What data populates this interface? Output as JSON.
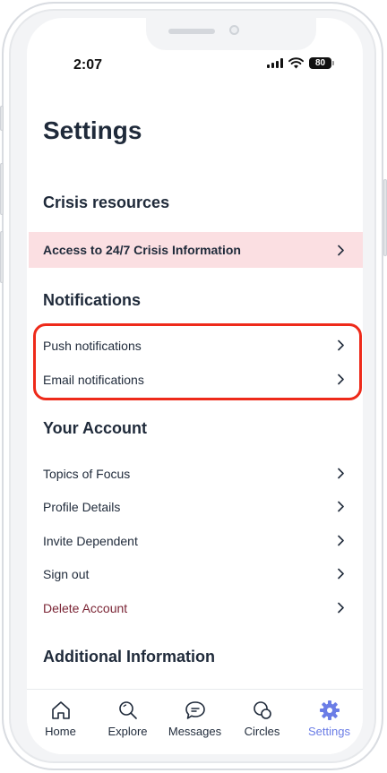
{
  "status_bar": {
    "time": "2:07",
    "battery": "80"
  },
  "page": {
    "title": "Settings"
  },
  "sections": {
    "crisis": {
      "title": "Crisis resources",
      "item": "Access to 24/7 Crisis Information"
    },
    "notifications": {
      "title": "Notifications",
      "items": [
        "Push notifications",
        "Email notifications"
      ]
    },
    "account": {
      "title": "Your Account",
      "items": [
        "Topics of Focus",
        "Profile Details",
        "Invite Dependent",
        "Sign out",
        "Delete Account"
      ]
    },
    "additional": {
      "title": "Additional Information"
    }
  },
  "tabbar": {
    "items": [
      {
        "label": "Home",
        "icon": "home-icon"
      },
      {
        "label": "Explore",
        "icon": "search-icon"
      },
      {
        "label": "Messages",
        "icon": "chat-icon"
      },
      {
        "label": "Circles",
        "icon": "circles-icon"
      },
      {
        "label": "Settings",
        "icon": "gear-icon"
      }
    ],
    "active": "Settings"
  },
  "colors": {
    "accent": "#6b7de6",
    "crisis_bg": "#fbdfe2",
    "highlight": "#ee2a1a",
    "danger_text": "#7a2434"
  }
}
